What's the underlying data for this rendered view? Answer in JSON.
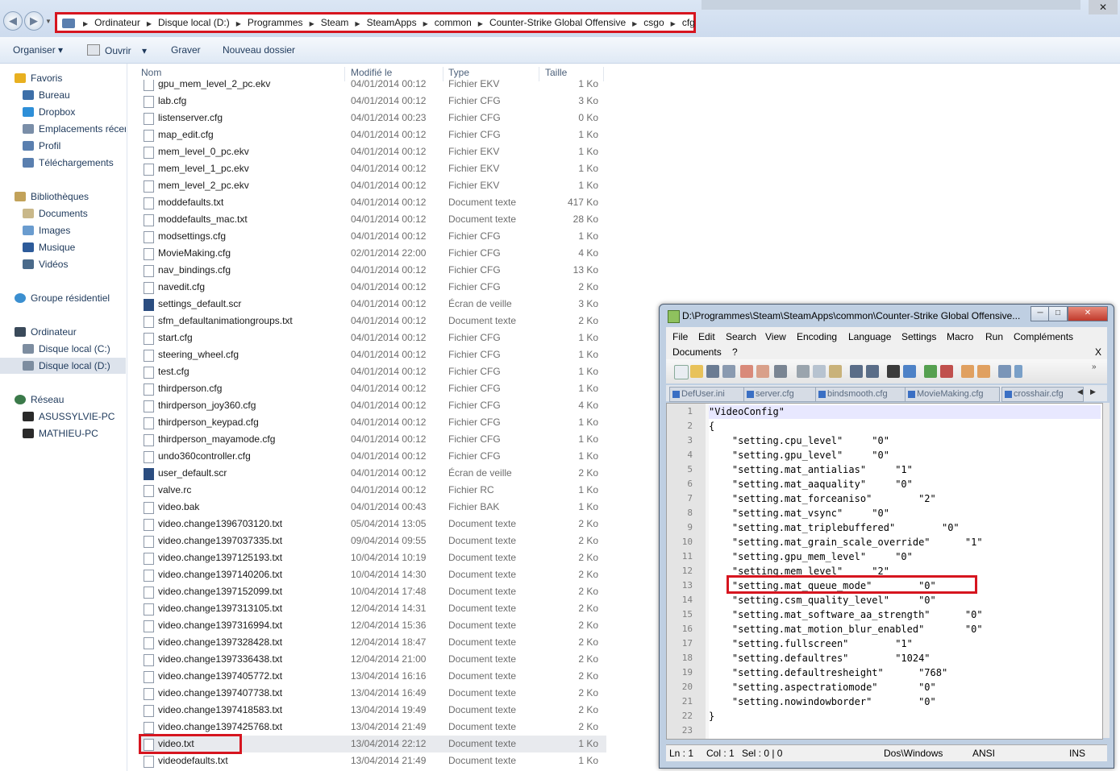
{
  "explorer": {
    "breadcrumbs": [
      "Ordinateur",
      "Disque local (D:)",
      "Programmes",
      "Steam",
      "SteamApps",
      "common",
      "Counter-Strike Global Offensive",
      "csgo",
      "cfg"
    ],
    "toolbar": {
      "organize": "Organiser",
      "open": "Ouvrir",
      "burn": "Graver",
      "new_folder": "Nouveau dossier"
    },
    "nav": {
      "favorites": "Favoris",
      "desktop": "Bureau",
      "dropbox": "Dropbox",
      "recent": "Emplacements récents",
      "profile": "Profil",
      "downloads": "Téléchargements",
      "libraries": "Bibliothèques",
      "documents": "Documents",
      "images": "Images",
      "music": "Musique",
      "videos": "Vidéos",
      "homegroup": "Groupe résidentiel",
      "computer": "Ordinateur",
      "drive_c": "Disque local (C:)",
      "drive_d": "Disque local (D:)",
      "network": "Réseau",
      "pc1": "ASUSSYLVIE-PC",
      "pc2": "MATHIEU-PC"
    },
    "columns": {
      "name": "Nom",
      "modified": "Modifié le",
      "type": "Type",
      "size": "Taille"
    },
    "files": [
      {
        "name": "gpu_mem_level_2_pc.ekv",
        "date": "04/01/2014 00:12",
        "type": "Fichier EKV",
        "size": "1 Ko"
      },
      {
        "name": "lab.cfg",
        "date": "04/01/2014 00:12",
        "type": "Fichier CFG",
        "size": "3 Ko"
      },
      {
        "name": "listenserver.cfg",
        "date": "04/01/2014 00:23",
        "type": "Fichier CFG",
        "size": "0 Ko"
      },
      {
        "name": "map_edit.cfg",
        "date": "04/01/2014 00:12",
        "type": "Fichier CFG",
        "size": "1 Ko"
      },
      {
        "name": "mem_level_0_pc.ekv",
        "date": "04/01/2014 00:12",
        "type": "Fichier EKV",
        "size": "1 Ko"
      },
      {
        "name": "mem_level_1_pc.ekv",
        "date": "04/01/2014 00:12",
        "type": "Fichier EKV",
        "size": "1 Ko"
      },
      {
        "name": "mem_level_2_pc.ekv",
        "date": "04/01/2014 00:12",
        "type": "Fichier EKV",
        "size": "1 Ko"
      },
      {
        "name": "moddefaults.txt",
        "date": "04/01/2014 00:12",
        "type": "Document texte",
        "size": "417 Ko"
      },
      {
        "name": "moddefaults_mac.txt",
        "date": "04/01/2014 00:12",
        "type": "Document texte",
        "size": "28 Ko"
      },
      {
        "name": "modsettings.cfg",
        "date": "04/01/2014 00:12",
        "type": "Fichier CFG",
        "size": "1 Ko"
      },
      {
        "name": "MovieMaking.cfg",
        "date": "02/01/2014 22:00",
        "type": "Fichier CFG",
        "size": "4 Ko"
      },
      {
        "name": "nav_bindings.cfg",
        "date": "04/01/2014 00:12",
        "type": "Fichier CFG",
        "size": "13 Ko"
      },
      {
        "name": "navedit.cfg",
        "date": "04/01/2014 00:12",
        "type": "Fichier CFG",
        "size": "2 Ko"
      },
      {
        "name": "settings_default.scr",
        "date": "04/01/2014 00:12",
        "type": "Écran de veille",
        "size": "3 Ko",
        "scr": true
      },
      {
        "name": "sfm_defaultanimationgroups.txt",
        "date": "04/01/2014 00:12",
        "type": "Document texte",
        "size": "2 Ko"
      },
      {
        "name": "start.cfg",
        "date": "04/01/2014 00:12",
        "type": "Fichier CFG",
        "size": "1 Ko"
      },
      {
        "name": "steering_wheel.cfg",
        "date": "04/01/2014 00:12",
        "type": "Fichier CFG",
        "size": "1 Ko"
      },
      {
        "name": "test.cfg",
        "date": "04/01/2014 00:12",
        "type": "Fichier CFG",
        "size": "1 Ko"
      },
      {
        "name": "thirdperson.cfg",
        "date": "04/01/2014 00:12",
        "type": "Fichier CFG",
        "size": "1 Ko"
      },
      {
        "name": "thirdperson_joy360.cfg",
        "date": "04/01/2014 00:12",
        "type": "Fichier CFG",
        "size": "4 Ko"
      },
      {
        "name": "thirdperson_keypad.cfg",
        "date": "04/01/2014 00:12",
        "type": "Fichier CFG",
        "size": "1 Ko"
      },
      {
        "name": "thirdperson_mayamode.cfg",
        "date": "04/01/2014 00:12",
        "type": "Fichier CFG",
        "size": "1 Ko"
      },
      {
        "name": "undo360controller.cfg",
        "date": "04/01/2014 00:12",
        "type": "Fichier CFG",
        "size": "1 Ko"
      },
      {
        "name": "user_default.scr",
        "date": "04/01/2014 00:12",
        "type": "Écran de veille",
        "size": "2 Ko",
        "scr": true
      },
      {
        "name": "valve.rc",
        "date": "04/01/2014 00:12",
        "type": "Fichier RC",
        "size": "1 Ko"
      },
      {
        "name": "video.bak",
        "date": "04/01/2014 00:43",
        "type": "Fichier BAK",
        "size": "1 Ko"
      },
      {
        "name": "video.change1396703120.txt",
        "date": "05/04/2014 13:05",
        "type": "Document texte",
        "size": "2 Ko"
      },
      {
        "name": "video.change1397037335.txt",
        "date": "09/04/2014 09:55",
        "type": "Document texte",
        "size": "2 Ko"
      },
      {
        "name": "video.change1397125193.txt",
        "date": "10/04/2014 10:19",
        "type": "Document texte",
        "size": "2 Ko"
      },
      {
        "name": "video.change1397140206.txt",
        "date": "10/04/2014 14:30",
        "type": "Document texte",
        "size": "2 Ko"
      },
      {
        "name": "video.change1397152099.txt",
        "date": "10/04/2014 17:48",
        "type": "Document texte",
        "size": "2 Ko"
      },
      {
        "name": "video.change1397313105.txt",
        "date": "12/04/2014 14:31",
        "type": "Document texte",
        "size": "2 Ko"
      },
      {
        "name": "video.change1397316994.txt",
        "date": "12/04/2014 15:36",
        "type": "Document texte",
        "size": "2 Ko"
      },
      {
        "name": "video.change1397328428.txt",
        "date": "12/04/2014 18:47",
        "type": "Document texte",
        "size": "2 Ko"
      },
      {
        "name": "video.change1397336438.txt",
        "date": "12/04/2014 21:00",
        "type": "Document texte",
        "size": "2 Ko"
      },
      {
        "name": "video.change1397405772.txt",
        "date": "13/04/2014 16:16",
        "type": "Document texte",
        "size": "2 Ko"
      },
      {
        "name": "video.change1397407738.txt",
        "date": "13/04/2014 16:49",
        "type": "Document texte",
        "size": "2 Ko"
      },
      {
        "name": "video.change1397418583.txt",
        "date": "13/04/2014 19:49",
        "type": "Document texte",
        "size": "2 Ko"
      },
      {
        "name": "video.change1397425768.txt",
        "date": "13/04/2014 21:49",
        "type": "Document texte",
        "size": "2 Ko"
      },
      {
        "name": "video.txt",
        "date": "13/04/2014 22:12",
        "type": "Document texte",
        "size": "1 Ko",
        "selected": true
      },
      {
        "name": "videodefaults.txt",
        "date": "13/04/2014 21:49",
        "type": "Document texte",
        "size": "1 Ko"
      }
    ]
  },
  "npp": {
    "title": "D:\\Programmes\\Steam\\SteamApps\\common\\Counter-Strike Global Offensive...",
    "menu": [
      "File",
      "Edit",
      "Search",
      "View",
      "Encoding",
      "Language",
      "Settings",
      "Macro",
      "Run",
      "Compléments",
      "Documents",
      "?"
    ],
    "close_doc": "X",
    "tabs": [
      "DefUser.ini",
      "server.cfg",
      "bindsmooth.cfg",
      "MovieMaking.cfg",
      "crosshair.cfg"
    ],
    "lines": [
      "\"VideoConfig\"",
      "{",
      "    \"setting.cpu_level\"     \"0\"",
      "    \"setting.gpu_level\"     \"0\"",
      "    \"setting.mat_antialias\"     \"1\"",
      "    \"setting.mat_aaquality\"     \"0\"",
      "    \"setting.mat_forceaniso\"        \"2\"",
      "    \"setting.mat_vsync\"     \"0\"",
      "    \"setting.mat_triplebuffered\"        \"0\"",
      "    \"setting.mat_grain_scale_override\"      \"1\"",
      "    \"setting.gpu_mem_level\"     \"0\"",
      "    \"setting.mem_level\"     \"2\"",
      "    \"setting.mat_queue_mode\"        \"0\"",
      "    \"setting.csm_quality_level\"     \"0\"",
      "    \"setting.mat_software_aa_strength\"      \"0\"",
      "    \"setting.mat_motion_blur_enabled\"       \"0\"",
      "    \"setting.fullscreen\"        \"1\"",
      "    \"setting.defaultres\"        \"1024\"",
      "    \"setting.defaultresheight\"      \"768\"",
      "    \"setting.aspectratiomode\"       \"0\"",
      "    \"setting.nowindowborder\"        \"0\"",
      "}",
      ""
    ],
    "status": {
      "ln": "Ln : 1",
      "col": "Col : 1",
      "sel": "Sel : 0 | 0",
      "eol": "Dos\\Windows",
      "enc": "ANSI",
      "mode": "INS"
    }
  }
}
